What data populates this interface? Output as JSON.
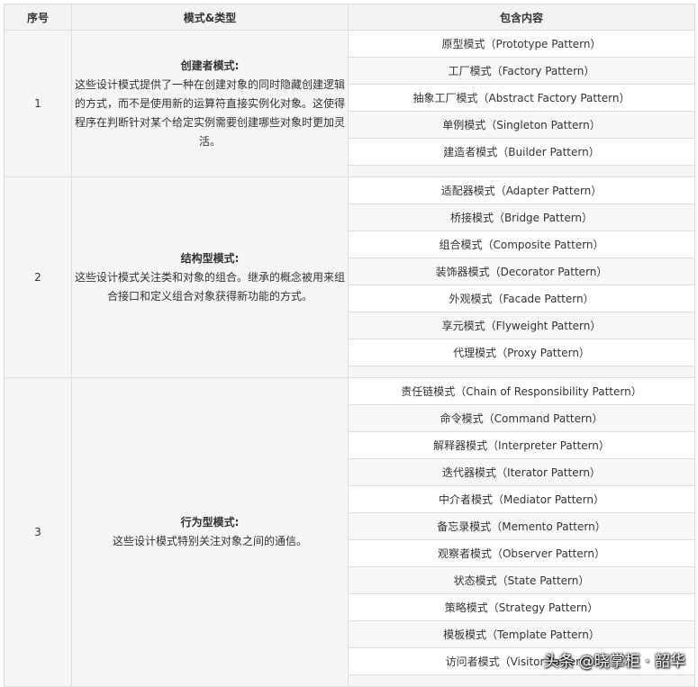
{
  "headers": {
    "index": "序号",
    "type": "模式&类型",
    "content": "包含内容"
  },
  "groups": [
    {
      "index": "1",
      "title": "创建者模式:",
      "desc": "这些设计模式提供了一种在创建对象的同时隐藏创建逻辑的方式，而不是使用新的运算符直接实例化对象。这使得程序在判断针对某个给定实例需要创建哪些对象时更加灵活。",
      "items": [
        "原型模式（Prototype Pattern）",
        "工厂模式（Factory Pattern）",
        "抽象工厂模式（Abstract Factory Pattern）",
        "单例模式（Singleton Pattern）",
        "建造者模式（Builder Pattern）"
      ]
    },
    {
      "index": "2",
      "title": "结构型模式:",
      "desc": "这些设计模式关注类和对象的组合。继承的概念被用来组合接口和定义组合对象获得新功能的方式。",
      "items": [
        "适配器模式（Adapter Pattern）",
        "桥接模式（Bridge Pattern）",
        "组合模式（Composite Pattern）",
        "装饰器模式（Decorator Pattern）",
        "外观模式（Facade Pattern）",
        "享元模式（Flyweight Pattern）",
        "代理模式（Proxy Pattern）"
      ]
    },
    {
      "index": "3",
      "title": "行为型模式:",
      "desc": "这些设计模式特别关注对象之间的通信。",
      "items": [
        "责任链模式（Chain of Responsibility Pattern）",
        "命令模式（Command Pattern）",
        "解释器模式（Interpreter Pattern）",
        "迭代器模式（Iterator Pattern）",
        "中介者模式（Mediator Pattern）",
        "备忘录模式（Memento Pattern）",
        "观察者模式（Observer Pattern）",
        "状态模式（State Pattern）",
        "策略模式（Strategy Pattern）",
        "模板模式（Template Pattern）",
        "访问者模式（Visitor Pattern）"
      ]
    }
  ],
  "watermark": "头条 @晓掌柜 · 韶华"
}
